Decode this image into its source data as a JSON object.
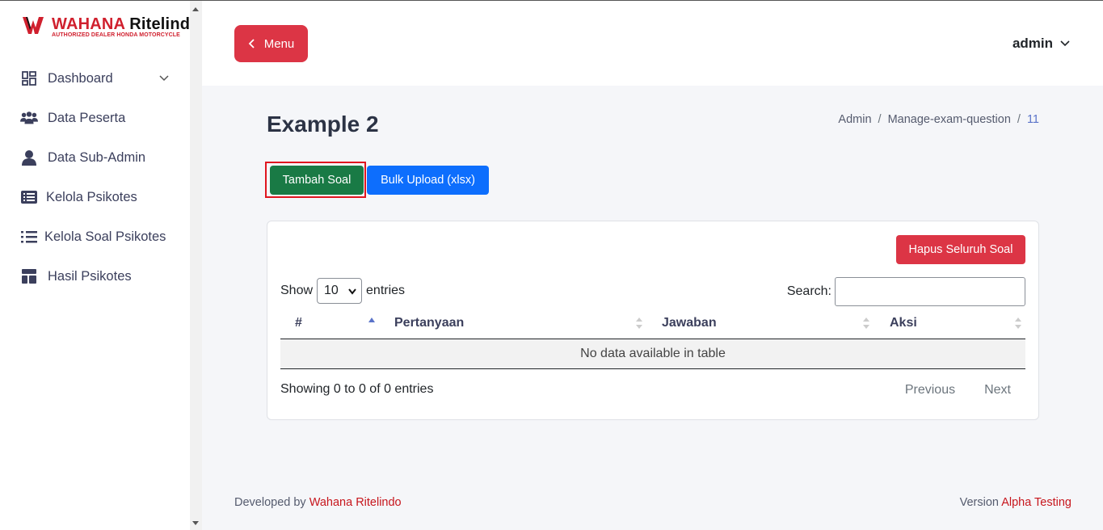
{
  "logo": {
    "brand_main": "WAHANA",
    "brand_sub": "Ritelindo",
    "tagline": "AUTHORIZED DEALER HONDA MOTORCYCLE"
  },
  "sidebar": {
    "items": [
      {
        "label": "Dashboard",
        "icon": "dashboard-icon"
      },
      {
        "label": "Data Peserta",
        "icon": "users-icon"
      },
      {
        "label": "Data Sub-Admin",
        "icon": "user-icon"
      },
      {
        "label": "Kelola Psikotes",
        "icon": "list-card-icon"
      },
      {
        "label": "Kelola Soal Psikotes",
        "icon": "list-icon"
      },
      {
        "label": "Hasil Psikotes",
        "icon": "layout-icon"
      }
    ]
  },
  "header": {
    "menu_label": "Menu",
    "user_label": "admin"
  },
  "page": {
    "title": "Example 2",
    "breadcrumb": [
      "Admin",
      "Manage-exam-question",
      "11"
    ],
    "breadcrumb_sep": "/"
  },
  "actions": {
    "add_label": "Tambah Soal",
    "bulk_label": "Bulk Upload (xlsx)",
    "delete_all_label": "Hapus Seluruh Soal"
  },
  "table": {
    "show_label": "Show",
    "entries_label": "entries",
    "page_size": "10",
    "search_label": "Search:",
    "columns": [
      "#",
      "Pertanyaan",
      "Jawaban",
      "Aksi"
    ],
    "empty_text": "No data available in table",
    "info_text": "Showing 0 to 0 of 0 entries",
    "prev_label": "Previous",
    "next_label": "Next"
  },
  "footer": {
    "developed_by_label": "Developed by",
    "developer": "Wahana Ritelindo",
    "version_label": "Version",
    "version": "Alpha Testing"
  },
  "colors": {
    "danger": "#dc3545",
    "success": "#197a45",
    "primary": "#0d6efd",
    "brand_red": "#c7161d"
  }
}
